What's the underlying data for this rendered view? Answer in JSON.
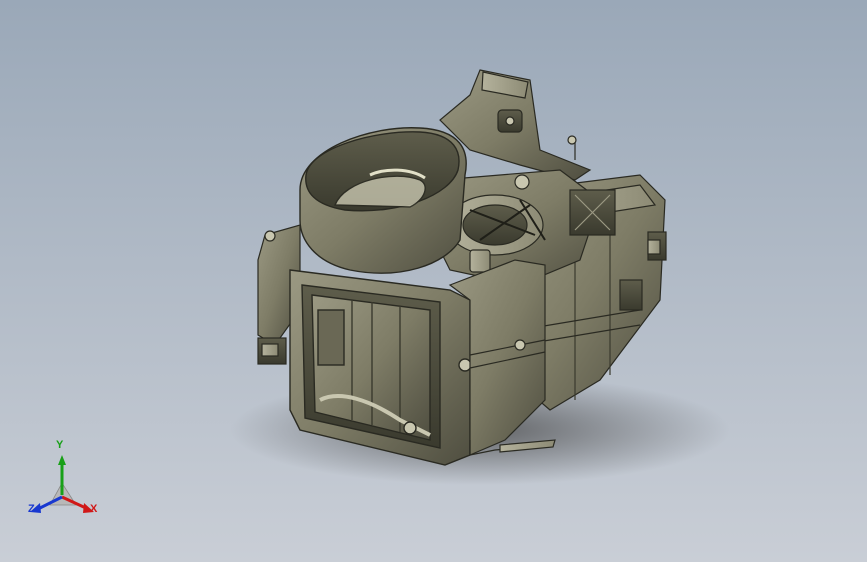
{
  "viewport": {
    "triad": {
      "x_label": "X",
      "y_label": "Y",
      "z_label": "Z",
      "x_color": "#d01818",
      "y_color": "#18a018",
      "z_color": "#1838d0"
    },
    "model": {
      "body_color": "#7e7c66",
      "shadow_color": "#4a4a4a"
    }
  }
}
